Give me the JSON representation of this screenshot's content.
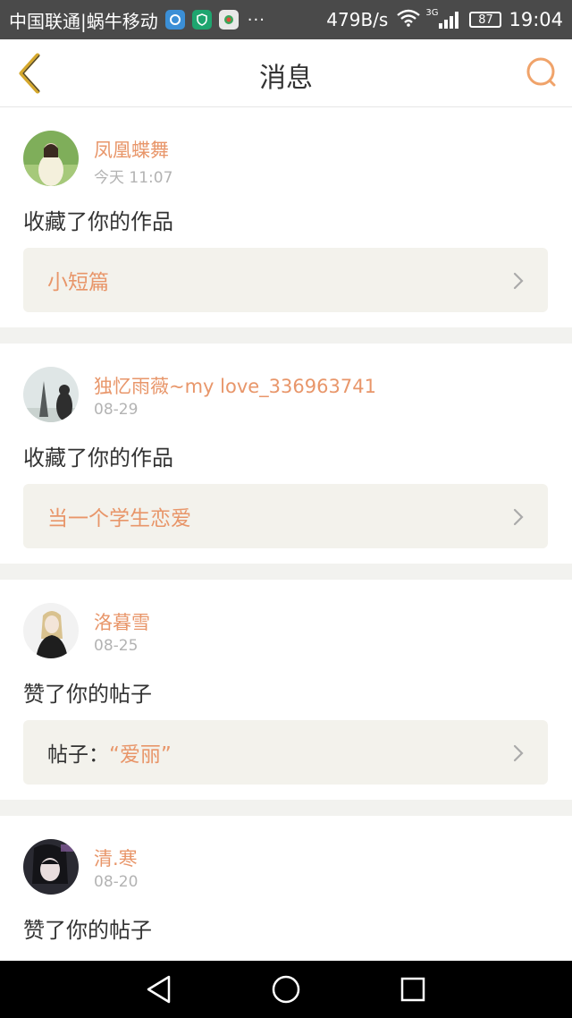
{
  "status_bar": {
    "carrier": "中国联通|蜗牛移动",
    "overflow": "···",
    "net_speed": "479B/s",
    "network_type": "3G",
    "battery": "87",
    "time": "19:04"
  },
  "header": {
    "title": "消息",
    "back_icon": "chevron-left-icon",
    "search_icon": "search-icon"
  },
  "colors": {
    "accent": "#e8966a",
    "back_icon": "#d4a72c",
    "card_box": "#f3f2ec",
    "page_bg": "#f2f2ef"
  },
  "messages": [
    {
      "username": "凤凰蝶舞",
      "time": "今天 11:07",
      "action": "收藏了你的作品",
      "target_prefix": "",
      "target_title": "小短篇"
    },
    {
      "username": "独忆雨薇~my love_336963741",
      "time": "08-29",
      "action": "收藏了你的作品",
      "target_prefix": "",
      "target_title": "当一个学生恋爱"
    },
    {
      "username": "洛暮雪",
      "time": "08-25",
      "action": "赞了你的帖子",
      "target_prefix": "帖子：",
      "target_title": "“爱丽”"
    },
    {
      "username": "清.寒",
      "time": "08-20",
      "action": "赞了你的帖子"
    }
  ],
  "nav_bar": {
    "back": "nav-back-icon",
    "home": "nav-home-icon",
    "recents": "nav-recents-icon"
  }
}
